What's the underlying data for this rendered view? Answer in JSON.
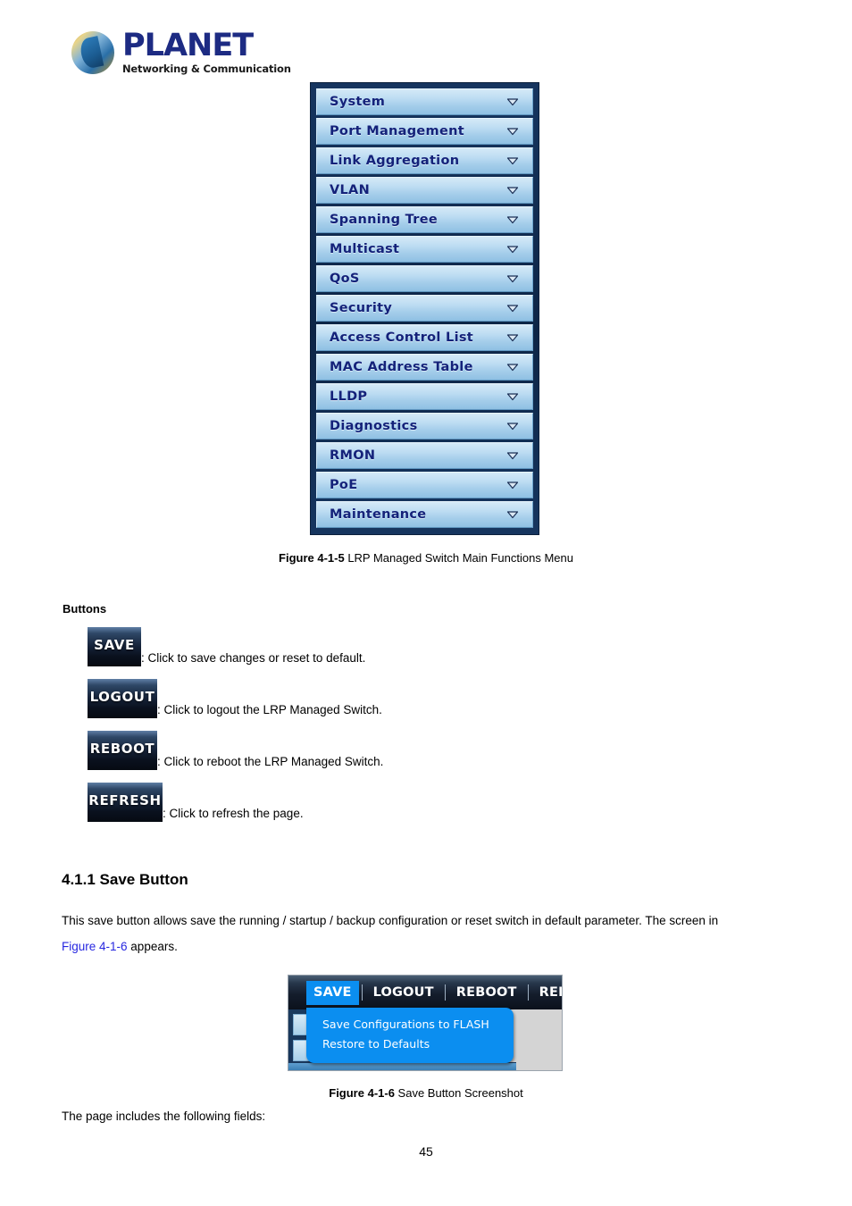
{
  "brand": {
    "name": "PLANET",
    "tagline": "Networking & Communication",
    "logo_icon": "planet-globe-logo",
    "name_color": "#1d2b83"
  },
  "main_menu_figure": {
    "items": [
      {
        "label": "System",
        "chevron_icon": "chevron-down-icon"
      },
      {
        "label": "Port Management",
        "chevron_icon": "chevron-down-icon"
      },
      {
        "label": "Link Aggregation",
        "chevron_icon": "chevron-down-icon"
      },
      {
        "label": "VLAN",
        "chevron_icon": "chevron-down-icon"
      },
      {
        "label": "Spanning Tree",
        "chevron_icon": "chevron-down-icon"
      },
      {
        "label": "Multicast",
        "chevron_icon": "chevron-down-icon"
      },
      {
        "label": "QoS",
        "chevron_icon": "chevron-down-icon"
      },
      {
        "label": "Security",
        "chevron_icon": "chevron-down-icon"
      },
      {
        "label": "Access Control List",
        "chevron_icon": "chevron-down-icon"
      },
      {
        "label": "MAC Address Table",
        "chevron_icon": "chevron-down-icon"
      },
      {
        "label": "LLDP",
        "chevron_icon": "chevron-down-icon"
      },
      {
        "label": "Diagnostics",
        "chevron_icon": "chevron-down-icon"
      },
      {
        "label": "RMON",
        "chevron_icon": "chevron-down-icon"
      },
      {
        "label": "PoE",
        "chevron_icon": "chevron-down-icon"
      },
      {
        "label": "Maintenance",
        "chevron_icon": "chevron-down-icon"
      }
    ],
    "caption_label": "Figure 4-1-5",
    "caption_text": " LRP Managed Switch Main Functions Menu",
    "item_text_color": "#14227a"
  },
  "buttons_section": {
    "heading": "Buttons",
    "items": [
      {
        "label": "SAVE",
        "description": ": Click to save changes or reset to default."
      },
      {
        "label": "LOGOUT",
        "description": ": Click to logout the LRP Managed Switch."
      },
      {
        "label": "REBOOT",
        "description": ": Click to reboot the LRP Managed Switch."
      },
      {
        "label": "REFRESH",
        "description": ": Click to refresh the page."
      }
    ]
  },
  "save_button_section": {
    "heading": "4.1.1 Save Button",
    "paragraph_line1": "This save button allows save the running / startup / backup configuration or reset switch in default parameter. The screen in",
    "paragraph_link": "Figure 4-1-6",
    "paragraph_line2_tail": " appears.",
    "link_color": "#2727e0",
    "trailing_text": "The page includes the following fields:"
  },
  "save_figure": {
    "topbar": [
      {
        "label": "SAVE",
        "active": true
      },
      {
        "label": "LOGOUT",
        "active": false
      },
      {
        "label": "REBOOT",
        "active": false
      },
      {
        "label": "REFRESH",
        "active": false
      }
    ],
    "dropdown_items": [
      "Save Configurations to FLASH",
      "Restore to Defaults"
    ],
    "accent_color": "#0b8ef0",
    "caption_label": "Figure 4-1-6",
    "caption_text": " Save Button Screenshot"
  },
  "footer": {
    "page_number": "45"
  }
}
